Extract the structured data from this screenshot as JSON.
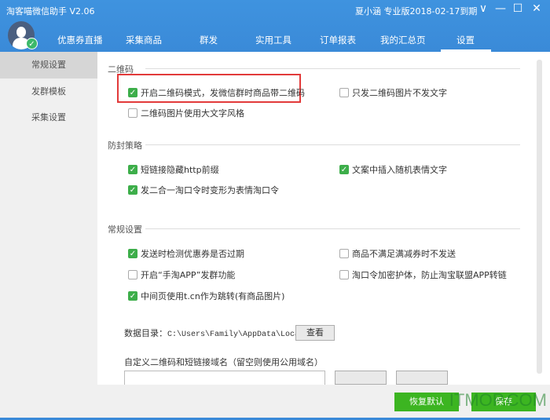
{
  "app": {
    "title": "淘客喵微信助手 V2.06",
    "user": "夏小涵 专业版2018-02-17到期"
  },
  "window_controls": [
    "dropdown-icon",
    "minimize-icon",
    "maximize-icon",
    "close-icon"
  ],
  "tabs": [
    {
      "label": "优惠券直播"
    },
    {
      "label": "采集商品"
    },
    {
      "label": "群发"
    },
    {
      "label": "实用工具"
    },
    {
      "label": "订单报表"
    },
    {
      "label": "我的汇总页"
    },
    {
      "label": "设置",
      "active": true
    }
  ],
  "sidebar": {
    "items": [
      {
        "label": "常规设置",
        "selected": true
      },
      {
        "label": "发群模板"
      },
      {
        "label": "采集设置"
      }
    ]
  },
  "sections": {
    "qr": {
      "title": "二维码",
      "options": [
        {
          "label": "开启二维码模式，发微信群时商品带二维码",
          "checked": true
        },
        {
          "label": "只发二维码图片不发文字",
          "checked": false
        },
        {
          "label": "二维码图片使用大文字风格",
          "checked": false
        }
      ]
    },
    "anti": {
      "title": "防封策略",
      "options": [
        {
          "label": "短链接隐藏http前缀",
          "checked": true
        },
        {
          "label": "文案中插入随机表情文字",
          "checked": true
        },
        {
          "label": "发二合一淘口令时变形为表情淘口令",
          "checked": true
        }
      ]
    },
    "general": {
      "title": "常规设置",
      "options": [
        {
          "label": "发送时检测优惠券是否过期",
          "checked": true
        },
        {
          "label": "商品不满足满减券时不发送",
          "checked": false
        },
        {
          "label": "开启“手淘APP”发群功能",
          "checked": false
        },
        {
          "label": "淘口令加密护体，防止淘宝联盟APP转链",
          "checked": false
        },
        {
          "label": "中间页使用t.cn作为跳转(有商品图片)",
          "checked": true
        }
      ]
    }
  },
  "data_dir": {
    "label": "数据目录：",
    "path": "C:\\Users\\Family\\AppData\\Local\\Mi",
    "view_button": "查看"
  },
  "domain": {
    "label": "自定义二维码和短链接域名（留空则使用公用域名）",
    "value": ""
  },
  "footer": {
    "reset": "恢复默认",
    "save": "保存"
  },
  "watermark": "ITMOP.COM",
  "colors": {
    "header": "#3a8ad8",
    "checkbox": "#3dae4a",
    "primary_button": "#3cb521",
    "highlight": "#e23a3a"
  }
}
